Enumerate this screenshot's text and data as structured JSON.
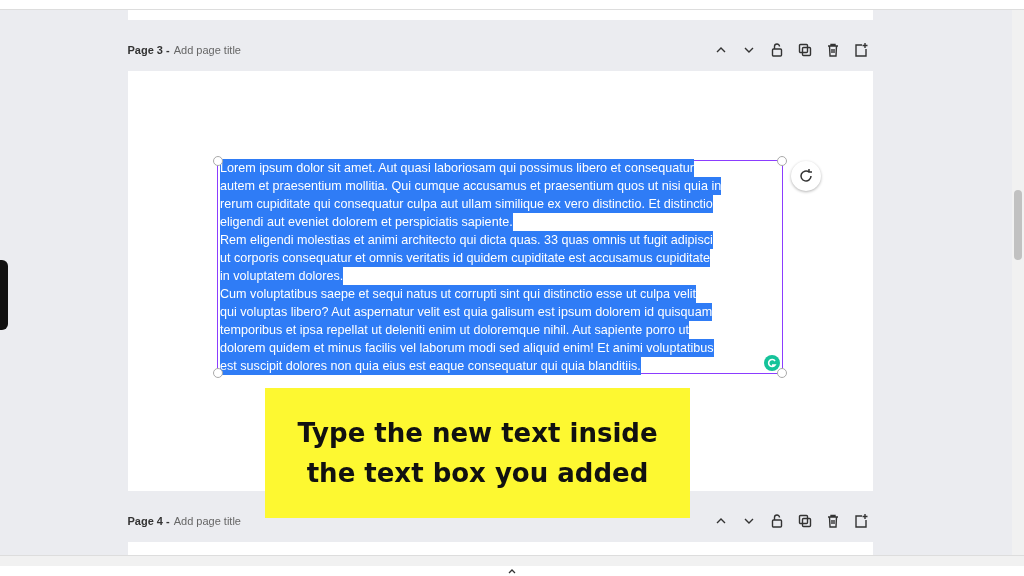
{
  "pages": [
    {
      "label": "Page 3 -",
      "title_placeholder": "Add page title",
      "text_box": {
        "selected": true,
        "lines": [
          "Lorem ipsum dolor sit amet. Aut quasi laboriosam qui possimus libero et consequatur",
          "autem et praesentium mollitia. Qui cumque accusamus et praesentium quos ut nisi quia in",
          "rerum cupiditate qui consequatur culpa aut ullam similique ex vero distinctio. Et distinctio",
          "eligendi aut eveniet dolorem et perspiciatis sapiente.",
          "Rem eligendi molestias et animi architecto qui dicta quas. 33 quas omnis ut fugit adipisci",
          "ut corporis consequatur et omnis veritatis id quidem cupiditate est accusamus cupiditate",
          "in voluptatem dolores.",
          "Cum voluptatibus saepe et sequi natus ut corrupti sint qui distinctio esse ut culpa velit",
          "qui voluptas libero? Aut aspernatur velit est quia galisum est ipsum dolorem id quisquam",
          "temporibus et ipsa repellat ut deleniti enim ut doloremque nihil. Aut sapiente porro ut",
          "dolorem quidem et minus facilis vel laborum modi sed aliquid enim! Et animi voluptatibus",
          "est suscipit dolores non quia eius est eaque consequatur qui quia blanditiis."
        ]
      }
    },
    {
      "label": "Page 4 -",
      "title_placeholder": "Add page title"
    }
  ],
  "caption": "Type the new text inside the text box you added"
}
